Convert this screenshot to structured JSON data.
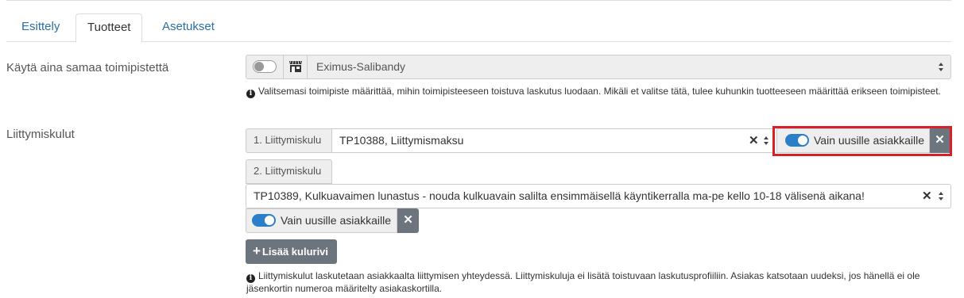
{
  "tabs": [
    {
      "label": "Esittely"
    },
    {
      "label": "Tuotteet"
    },
    {
      "label": "Asetukset"
    }
  ],
  "office_row": {
    "label": "Käytä aina samaa toimipistettä",
    "toggle_on": false,
    "selected": "Eximus-Salibandy",
    "help": "Valitsemasi toimipiste määrittää, mihin toimipisteeseen toistuva laskutus luodaan. Mikäli et valitse tätä, tulee kuhunkin tuotteeseen määrittää erikseen toimipisteet."
  },
  "fees_row": {
    "label": "Liittymiskulut",
    "items": [
      {
        "addon": "1. Liittymiskulu",
        "value": "TP10388, Liittymismaksu",
        "new_only_label": "Vain uusille asiakkaille",
        "new_only_on": true
      },
      {
        "addon": "2. Liittymiskulu",
        "value": "TP10389, Kulkuavaimen lunastus - nouda kulkuavain salilta ensimmäisellä käyntikerralla ma-pe kello 10-18 välisenä aikana!",
        "new_only_label": "Vain uusille asiakkaille",
        "new_only_on": true
      }
    ],
    "add_label": "Lisää kulurivi",
    "help": "Liittymiskulut laskutetaan asiakkaalta liittymisen yhteydessä. Liittymiskuluja ei lisätä toistuvaan laskutusprofiiliin. Asiakas katsotaan uudeksi, jos hänellä ei ole jäsenkortin numeroa määritelty asiakaskortilla."
  },
  "colors": {
    "link": "#2a6fa6",
    "toggle_on": "#2a7fc8",
    "highlight": "#d9202a",
    "remove_button": "#6c757d"
  }
}
